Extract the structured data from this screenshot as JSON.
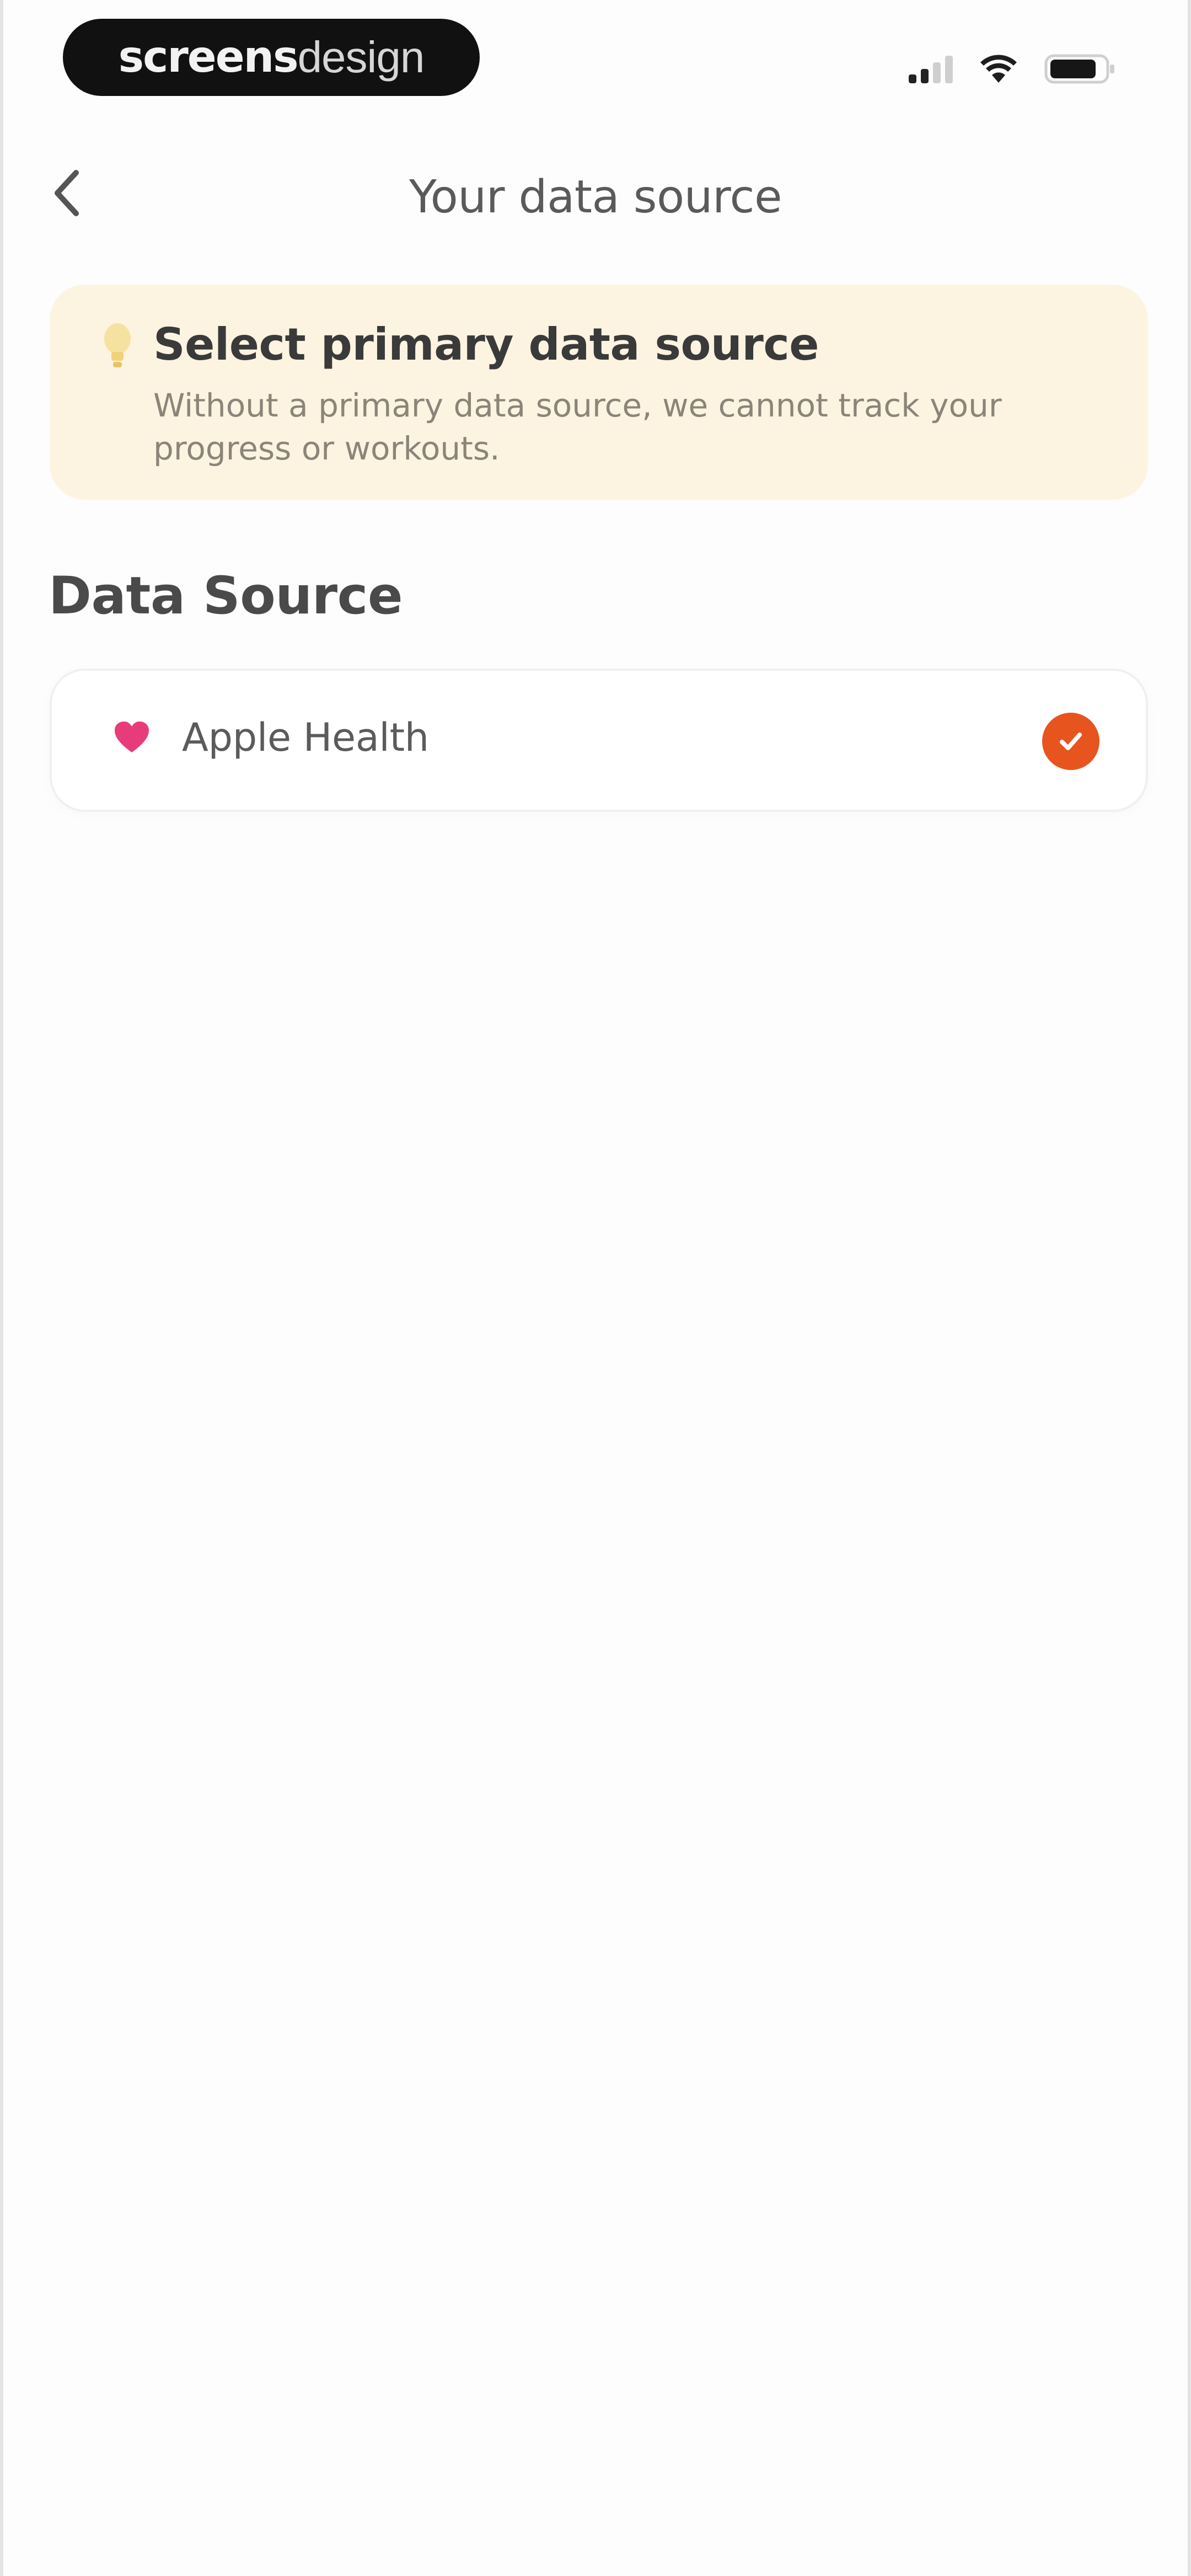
{
  "status_bar": {
    "brand_bold": "screens",
    "brand_light": "design",
    "icons": [
      "signal-icon",
      "wifi-icon",
      "battery-icon"
    ]
  },
  "header": {
    "back_icon": "chevron-left-icon",
    "title": "Your data source"
  },
  "banner": {
    "icon": "lightbulb-icon",
    "title": "Select primary data source",
    "body": "Without a primary data source, we cannot track your progress or workouts."
  },
  "section": {
    "heading": "Data Source"
  },
  "sources": [
    {
      "icon": "heart-icon",
      "label": "Apple Health",
      "selected": true
    }
  ],
  "colors": {
    "accent": "#e8541e",
    "banner_bg": "#fdf3e1",
    "heart": "#e83c7a",
    "bulb": "#f3d98a"
  }
}
